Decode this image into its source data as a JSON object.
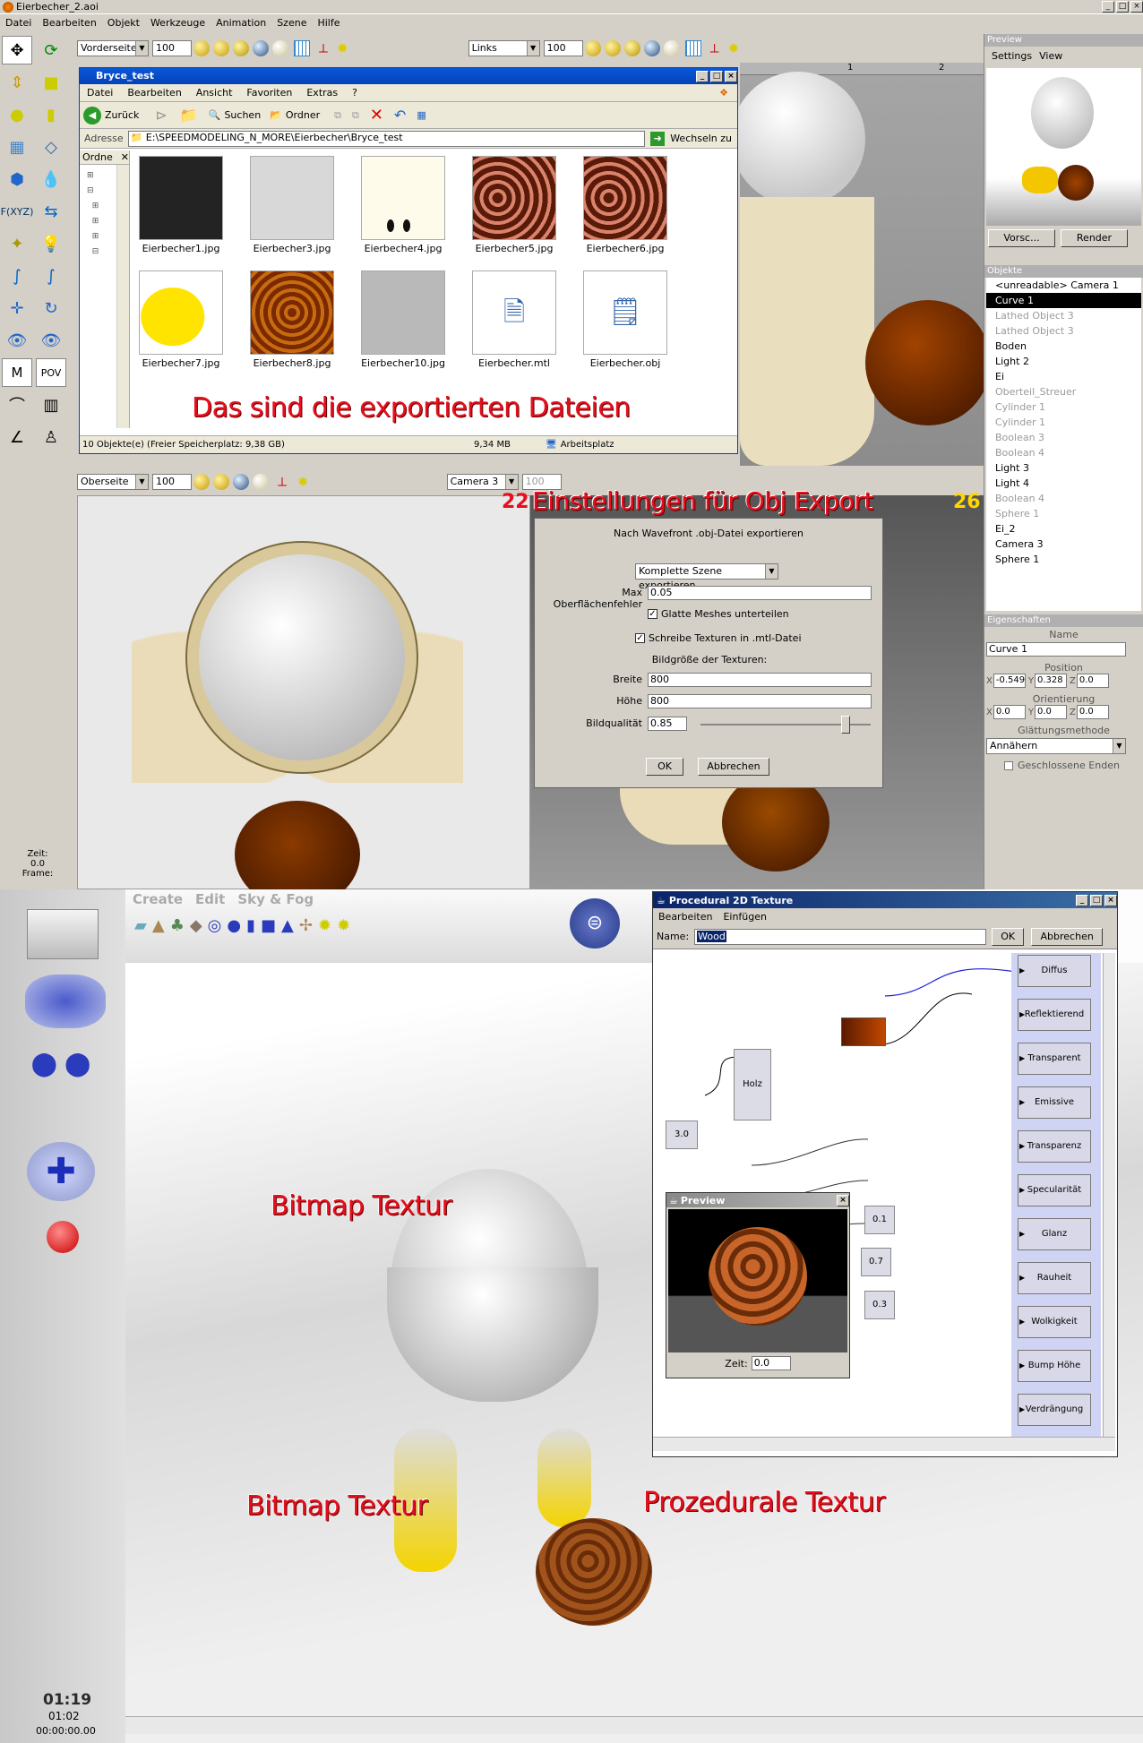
{
  "window": {
    "title": "Eierbecher_2.aoi"
  },
  "menubar": [
    "Datei",
    "Bearbeiten",
    "Objekt",
    "Werkzeuge",
    "Animation",
    "Szene",
    "Hilfe"
  ],
  "toolbar": {
    "left_view": "Vorderseite",
    "left_zoom": "100",
    "right_view": "Links",
    "right_zoom": "100"
  },
  "lower_toolbar": {
    "left_view": "Oberseite",
    "left_zoom": "100",
    "right_view": "Camera 3",
    "right_zoom": "100"
  },
  "left_tools": {
    "fxyz": "F(XYZ)",
    "m": "M",
    "pov": "POV"
  },
  "time_info": {
    "zeit_label": "Zeit:",
    "zeit_value": "0.0",
    "frame_label": "Frame:"
  },
  "ruler": {
    "mark1": "1",
    "mark2": "2"
  },
  "frame_counters": {
    "left": "22",
    "right": "26"
  },
  "explorer": {
    "title": "Bryce_test",
    "menu": [
      "Datei",
      "Bearbeiten",
      "Ansicht",
      "Favoriten",
      "Extras",
      "?"
    ],
    "back": "Zurück",
    "search": "Suchen",
    "folders": "Ordner",
    "address_label": "Adresse",
    "address": "E:\\SPEEDMODELING_N_MORE\\Eierbecher\\Bryce_test",
    "go": "Wechseln zu",
    "tree_title": "Ordne",
    "files": [
      {
        "name": "Eierbecher1.jpg"
      },
      {
        "name": "Eierbecher3.jpg"
      },
      {
        "name": "Eierbecher4.jpg"
      },
      {
        "name": "Eierbecher5.jpg"
      },
      {
        "name": "Eierbecher6.jpg"
      },
      {
        "name": "Eierbecher7.jpg"
      },
      {
        "name": "Eierbecher8.jpg"
      },
      {
        "name": "Eierbecher10.jpg"
      },
      {
        "name": "Eierbecher.mtl"
      },
      {
        "name": "Eierbecher.obj"
      }
    ],
    "status_left": "10 Objekte(e) (Freier Speicherplatz: 9,38 GB)",
    "status_size": "9,34 MB",
    "status_right": "Arbeitsplatz"
  },
  "annotations": {
    "exported": "Das sind die exportierten Dateien",
    "obj_settings": "Einstellungen für Obj Export",
    "bitmap1": "Bitmap Textur",
    "bitmap2": "Bitmap Textur",
    "procedural": "Prozedurale Textur"
  },
  "obj_dialog": {
    "heading": "Nach Wavefront .obj-Datei exportieren",
    "scope": "Komplette Szene exportieren",
    "max_error_label": "Max Oberflächenfehler",
    "max_error": "0.05",
    "smooth_label": "Glatte Meshes unterteilen",
    "mtl_label": "Schreibe Texturen in .mtl-Datei",
    "size_heading": "Bildgröße der Texturen:",
    "width_label": "Breite",
    "width": "800",
    "height_label": "Höhe",
    "height": "800",
    "quality_label": "Bildqualität",
    "quality": "0.85",
    "quality_level": 0.85,
    "ok": "OK",
    "cancel": "Abbrechen"
  },
  "preview_panel": {
    "title": "Preview",
    "menu": [
      "Settings",
      "View"
    ],
    "btn1": "Vorsc...",
    "btn2": "Render"
  },
  "objects_panel": {
    "title": "Objekte",
    "items": [
      {
        "label": "<unreadable> Camera 1",
        "state": "normal"
      },
      {
        "label": "Curve 1",
        "state": "selected"
      },
      {
        "label": "Lathed Object 3",
        "state": "grey"
      },
      {
        "label": "Lathed Object 3",
        "state": "grey"
      },
      {
        "label": "Boden",
        "state": "normal"
      },
      {
        "label": "Light 2",
        "state": "normal"
      },
      {
        "label": "Ei",
        "state": "normal"
      },
      {
        "label": "Oberteil_Streuer",
        "state": "grey"
      },
      {
        "label": "Cylinder 1",
        "state": "grey"
      },
      {
        "label": "Cylinder 1",
        "state": "grey"
      },
      {
        "label": "Boolean 3",
        "state": "grey"
      },
      {
        "label": "Boolean 4",
        "state": "grey"
      },
      {
        "label": "Light 3",
        "state": "normal"
      },
      {
        "label": "Light 4",
        "state": "normal"
      },
      {
        "label": "Boolean 4",
        "state": "grey"
      },
      {
        "label": "Sphere 1",
        "state": "grey"
      },
      {
        "label": "Ei_2",
        "state": "normal"
      },
      {
        "label": "Camera 3",
        "state": "normal"
      },
      {
        "label": "Sphere 1",
        "state": "normal"
      }
    ]
  },
  "properties_panel": {
    "title": "Eigenschaften",
    "name_label": "Name",
    "name": "Curve 1",
    "position_label": "Position",
    "pos_x": "-0.549",
    "pos_y": "0.328",
    "pos_z": "0.0",
    "orientation_label": "Orientierung",
    "rot_x": "0.0",
    "rot_y": "0.0",
    "rot_z": "0.0",
    "smoothing_label": "Glättungsmethode",
    "smoothing": "Annähern",
    "closed_ends": "Geschlossene Enden",
    "x": "X",
    "y": "Y",
    "z": "Z"
  },
  "bryce": {
    "menu": [
      "Create",
      "Edit",
      "Sky & Fog"
    ],
    "time_big": "01:19",
    "time_small": "01:02",
    "timecode": "00:00:00.00"
  },
  "texture_window": {
    "title": "Procedural 2D Texture",
    "menu": [
      "Bearbeiten",
      "Einfügen"
    ],
    "name_label": "Name:",
    "name": "Wood",
    "ok": "OK",
    "cancel": "Abbrechen",
    "nodes": {
      "holz": "Holz",
      "const1": "3.0",
      "v1": "0.1",
      "v2": "0.7",
      "v3": "0.3"
    },
    "outputs": [
      "Diffus",
      "Reflektierend",
      "Transparent",
      "Emissive",
      "Transparenz",
      "Specularität",
      "Glanz",
      "Rauheit",
      "Wolkigkeit",
      "Bump Höhe",
      "Verdrängung"
    ],
    "preview_title": "Preview",
    "zeit_label": "Zeit:",
    "zeit": "0.0"
  }
}
